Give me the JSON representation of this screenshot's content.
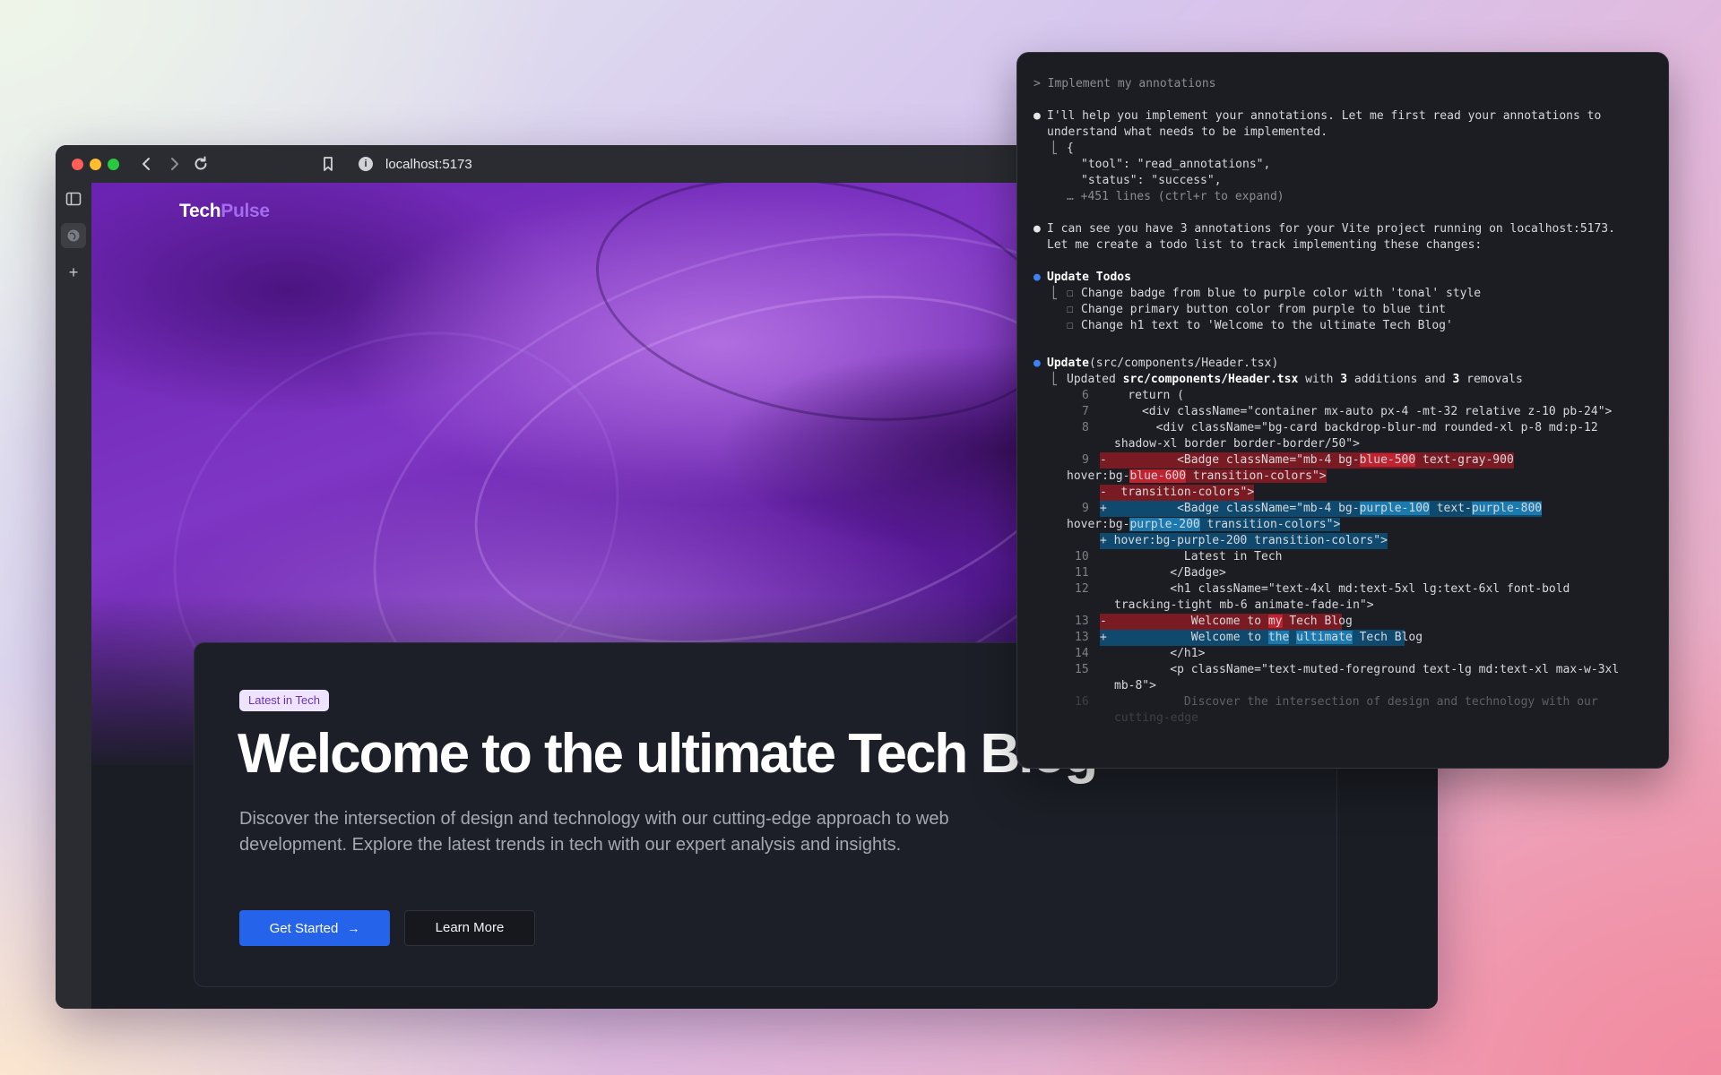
{
  "browser": {
    "url": "localhost:5173",
    "site": {
      "logo_part1": "Tech",
      "logo_part2": "Pulse",
      "badge": "Latest in Tech",
      "headline": "Welcome to the ultimate Tech Blog",
      "lead": "Discover the intersection of design and technology with our cutting-edge approach to web development. Explore the latest trends in tech with our expert analysis and insights.",
      "primary_button": "Get Started",
      "secondary_button": "Learn More"
    }
  },
  "terminal": {
    "prompt": "> Implement my annotations",
    "msg1_a": "I'll help you implement your annotations. Let me first read your annotations to",
    "msg1_b": "understand what needs to be implemented.",
    "json_open": "{",
    "json_tool": "\"tool\": \"read_annotations\",",
    "json_status": "\"status\": \"success\",",
    "json_more": "… +451 lines (ctrl+r to expand)",
    "msg2_a": "I can see you have 3 annotations for your Vite project running on localhost:5173.",
    "msg2_b": "Let me create a todo list to track implementing these changes:",
    "todos_title": "Update Todos",
    "todos": [
      "Change badge from blue to purple color with 'tonal' style",
      "Change primary button color from purple to blue tint",
      "Change h1 text to 'Welcome to the ultimate Tech Blog'"
    ],
    "update_label": "Update",
    "update_file": "(src/components/Header.tsx)",
    "updated_prefix": "Updated ",
    "updated_file": "src/components/Header.tsx",
    "updated_with": " with ",
    "additions_count": "3",
    "additions_and": " additions and ",
    "removals_count": "3",
    "removals": " removals",
    "diff": {
      "l6_num": "6",
      "l6": "    return (",
      "l7_num": "7",
      "l7": "      <div className=\"container mx-auto px-4 -mt-32 relative z-10 pb-24\">",
      "l8_num": "8",
      "l8": "        <div className=\"bg-card backdrop-blur-md rounded-xl p-8 md:p-12",
      "l8b": "shadow-xl border border-border/50\">",
      "d9_num": "9",
      "d9_sign": "-",
      "d9_pre": "          <Badge className=\"mb-4 bg-",
      "d9_hi1": "blue-500",
      "d9_mid": " text-gray-900",
      "d9b_pre": "hover:bg-",
      "d9b_hi": "blue-600",
      "d9b_post": " transition-colors\">",
      "d9c": "-  transition-colors\">",
      "a9_num": "9",
      "a9_sign": "+",
      "a9_pre": "          <Badge className=\"mb-4 bg-",
      "a9_hi1": "purple-100",
      "a9_mid": " text-",
      "a9_hi2": "purple-800",
      "a9b_pre": "hover:bg-",
      "a9b_hi": "purple-200",
      "a9b_post": " transition-colors\">",
      "a9c": "+ hover:bg-purple-200 transition-colors\">",
      "l10_num": "10",
      "l10": "            Latest in Tech",
      "l11_num": "11",
      "l11": "          </Badge>",
      "l12_num": "12",
      "l12": "          <h1 className=\"text-4xl md:text-5xl lg:text-6xl font-bold",
      "l12b": "tracking-tight mb-6 animate-fade-in\">",
      "d13_num": "13",
      "d13_sign": "-",
      "d13_pre": "            Welcome to ",
      "d13_hi": "my",
      "d13_post": " Tech Blog",
      "a13_num": "13",
      "a13_sign": "+",
      "a13_pre": "            Welcome to ",
      "a13_hi1": "the",
      "a13_hi2": "ultimate",
      "a13_post": " Tech Blog",
      "l14_num": "14",
      "l14": "          </h1>",
      "l15_num": "15",
      "l15": "          <p className=\"text-muted-foreground text-lg md:text-xl max-w-3xl",
      "l15b": "mb-8\">",
      "l16_num": "16",
      "l16": "            Discover the intersection of design and technology with our",
      "l16b": "cutting-edge"
    }
  },
  "colors": {
    "primary_button": "#2563eb",
    "badge_bg": "#efe4ff",
    "logo_accent": "#a46bf0",
    "diff_removed": "#7a1b24",
    "diff_added": "#0f4a6e"
  }
}
